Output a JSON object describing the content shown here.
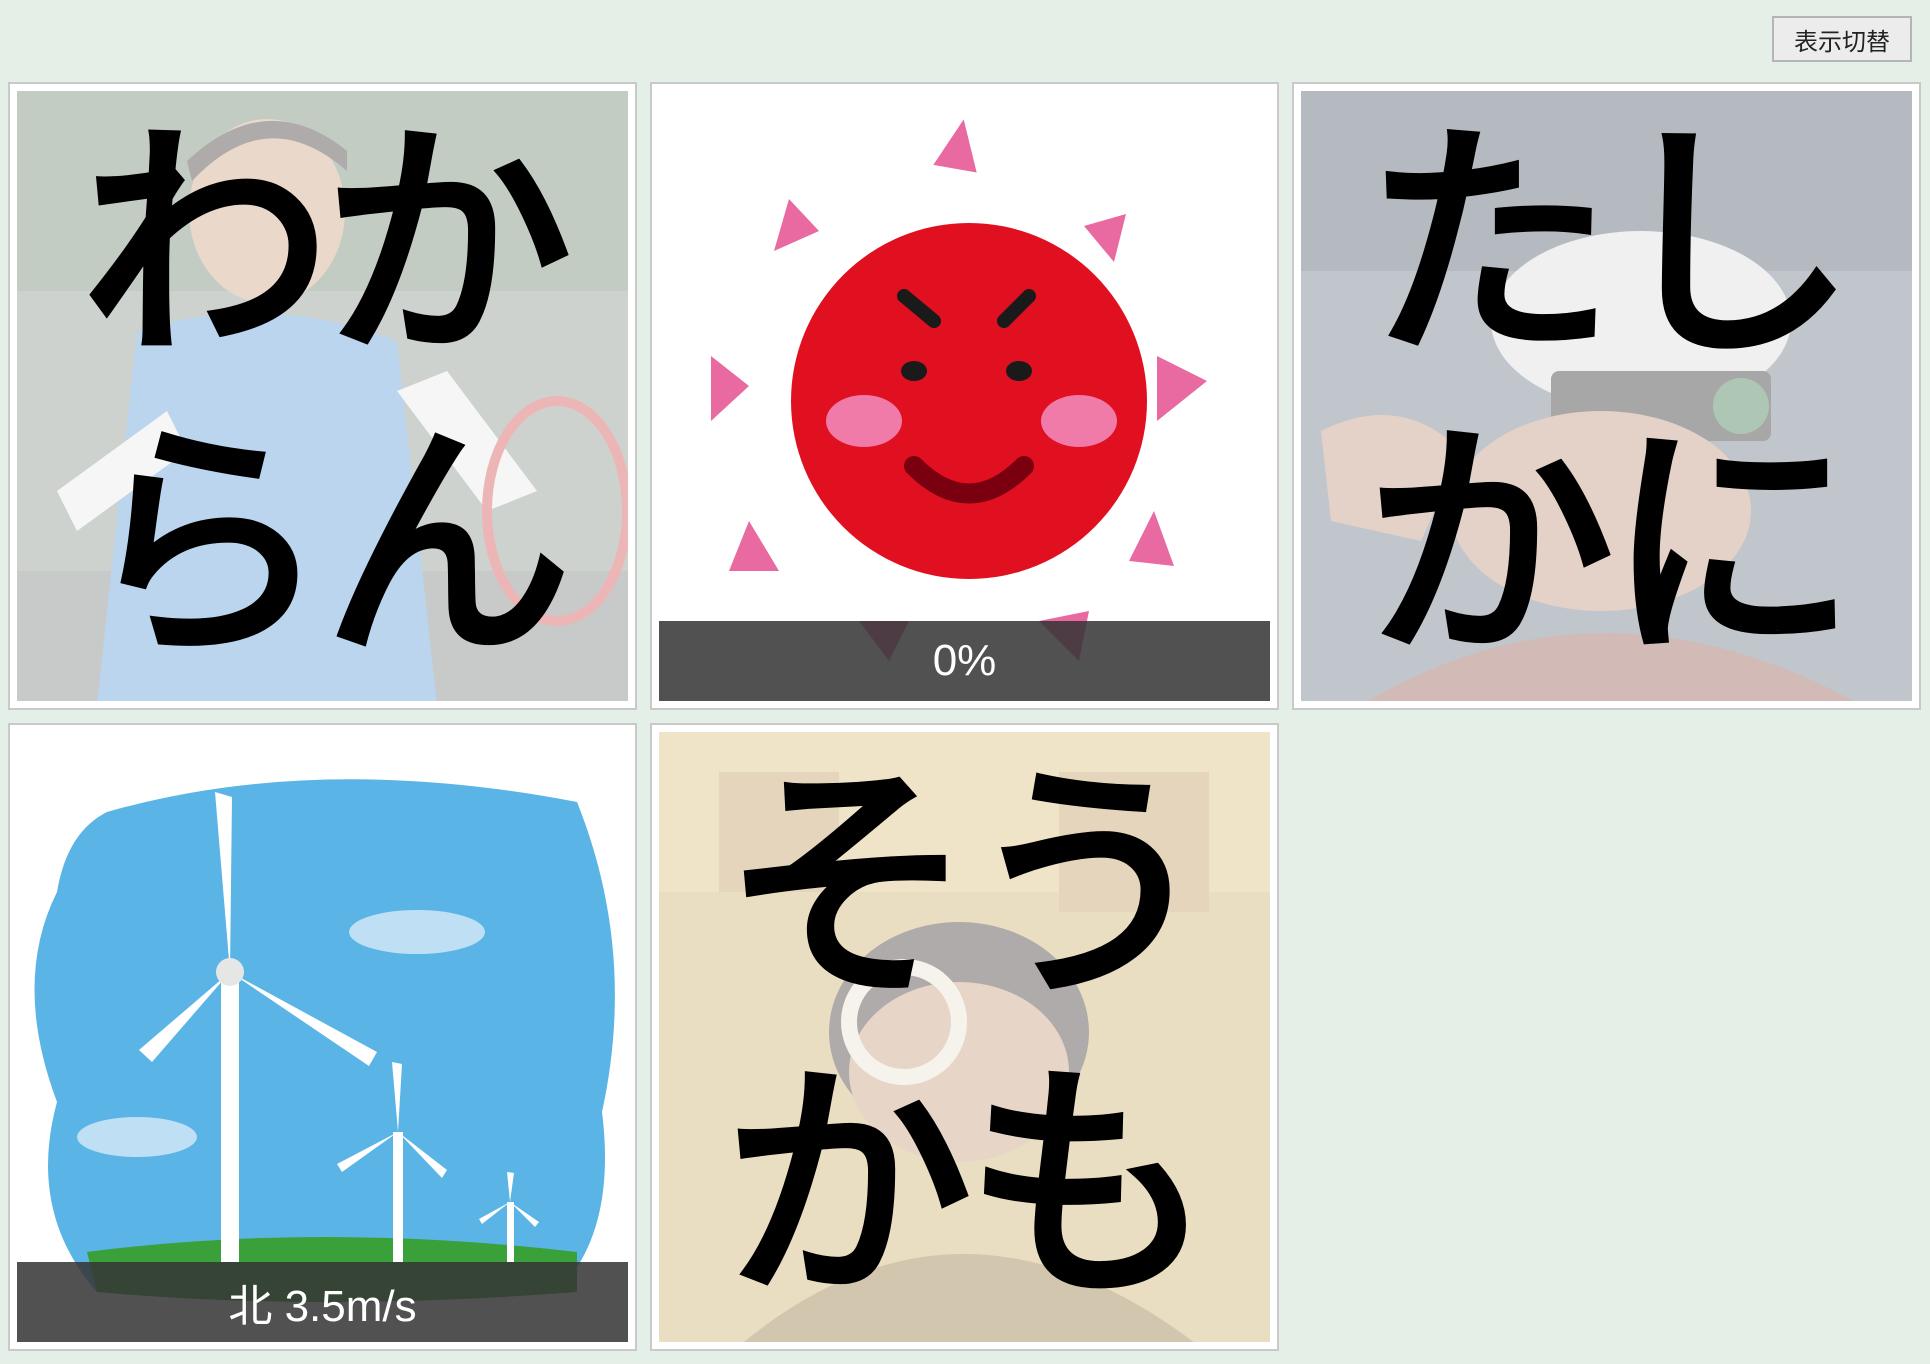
{
  "toolbar": {
    "toggle_label": "表示切替"
  },
  "tiles": [
    {
      "lines": [
        "わか",
        "らん"
      ],
      "photo": "tennis-player-photo"
    },
    {
      "icon": "angry-sun-icon",
      "caption": "0%"
    },
    {
      "lines": [
        "たし",
        "かに"
      ],
      "photo": "man-with-camera-photo"
    },
    {
      "icon": "wind-turbines-icon",
      "caption": "北 3.5m/s"
    },
    {
      "lines": [
        "そう",
        "かも"
      ],
      "photo": "man-with-magnifier-photo"
    }
  ],
  "colors": {
    "background": "#e4efe8",
    "sun_red": "#e01020",
    "sun_ray_pink": "#e86aa0",
    "sky_blue": "#5ab4e6",
    "grass_green": "#3aa03a"
  }
}
